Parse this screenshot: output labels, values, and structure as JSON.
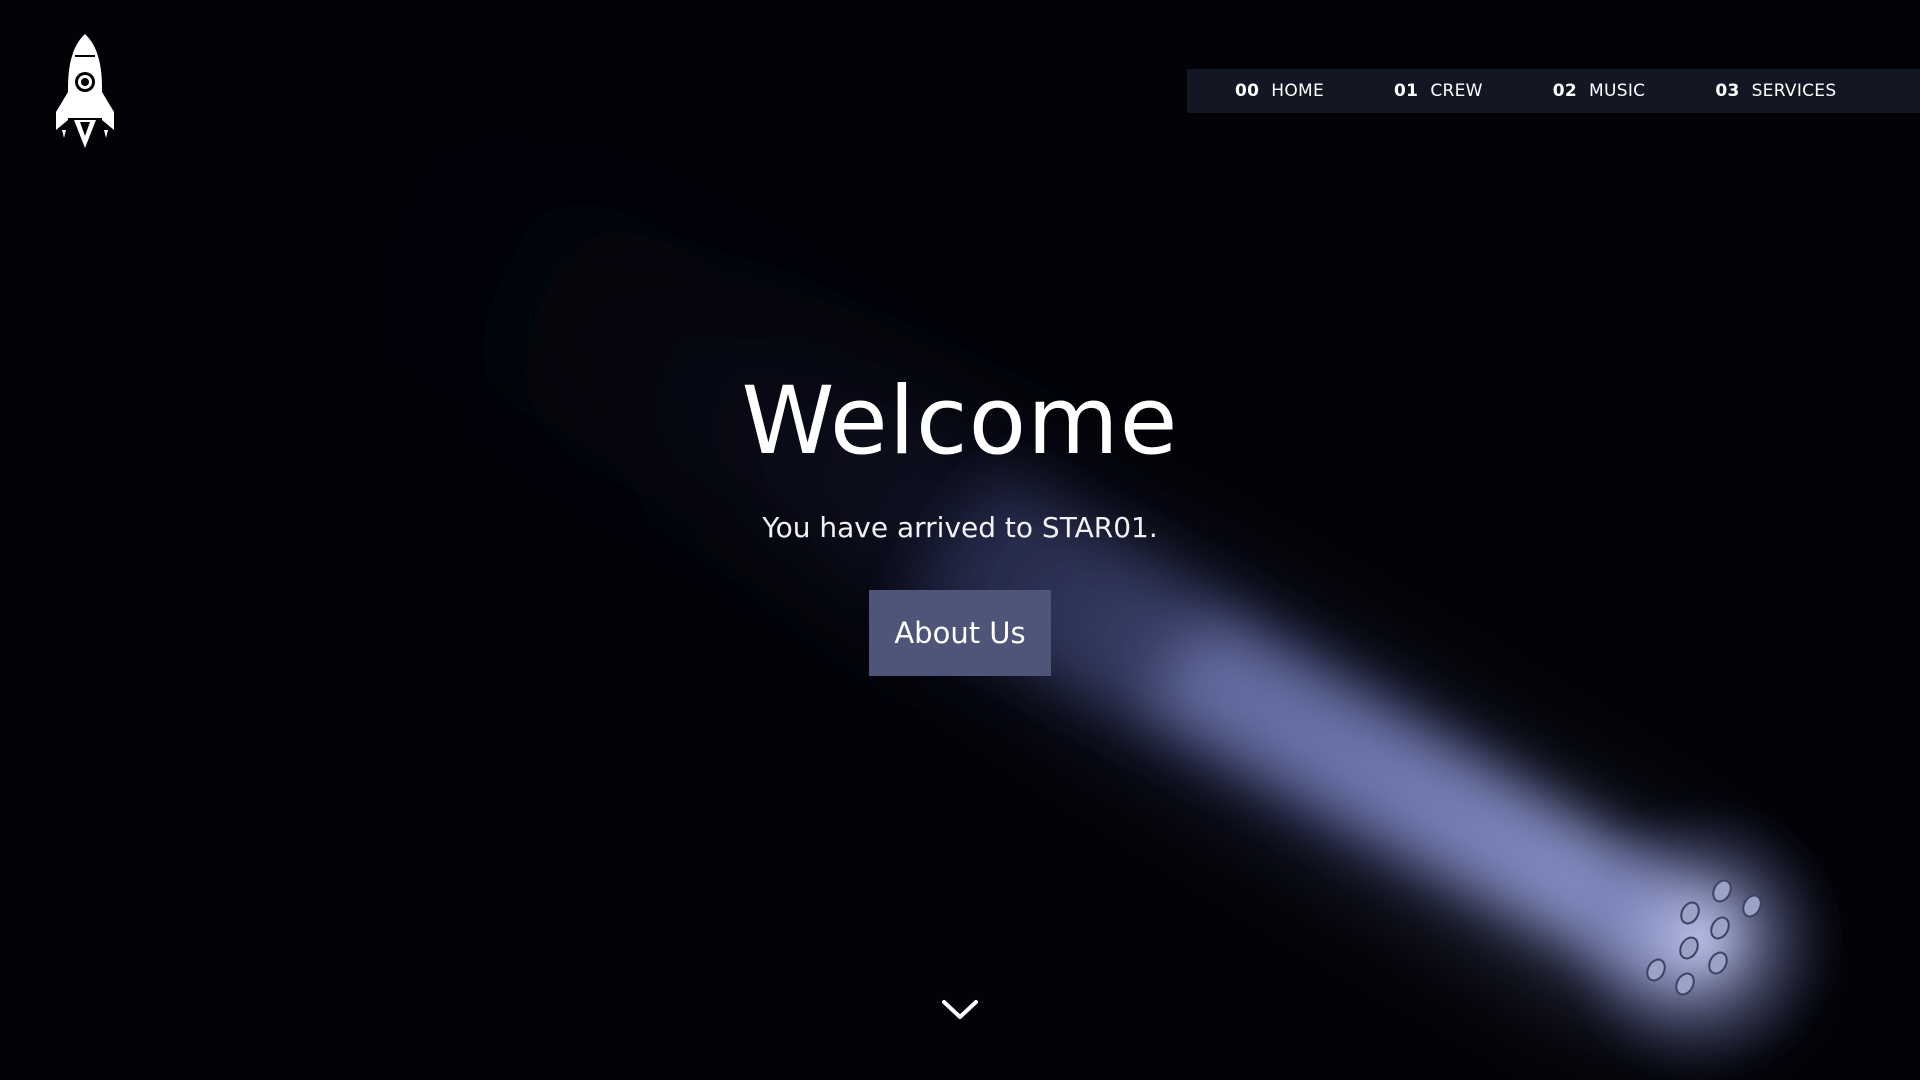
{
  "brand": {
    "logo_icon": "rocket-icon"
  },
  "nav": {
    "items": [
      {
        "num": "00",
        "label": "HOME"
      },
      {
        "num": "01",
        "label": "CREW"
      },
      {
        "num": "02",
        "label": "MUSIC"
      },
      {
        "num": "03",
        "label": "SERVICES"
      }
    ]
  },
  "hero": {
    "title": "Welcome",
    "subtitle": "You have arrived to STAR01.",
    "button_label": "About Us"
  },
  "scroll": {
    "icon": "chevron-down-icon"
  },
  "colors": {
    "background": "#020207",
    "nav_background": "#161a28",
    "button": "#4e5579",
    "beam": "#7a85c4",
    "text": "#ffffff"
  }
}
